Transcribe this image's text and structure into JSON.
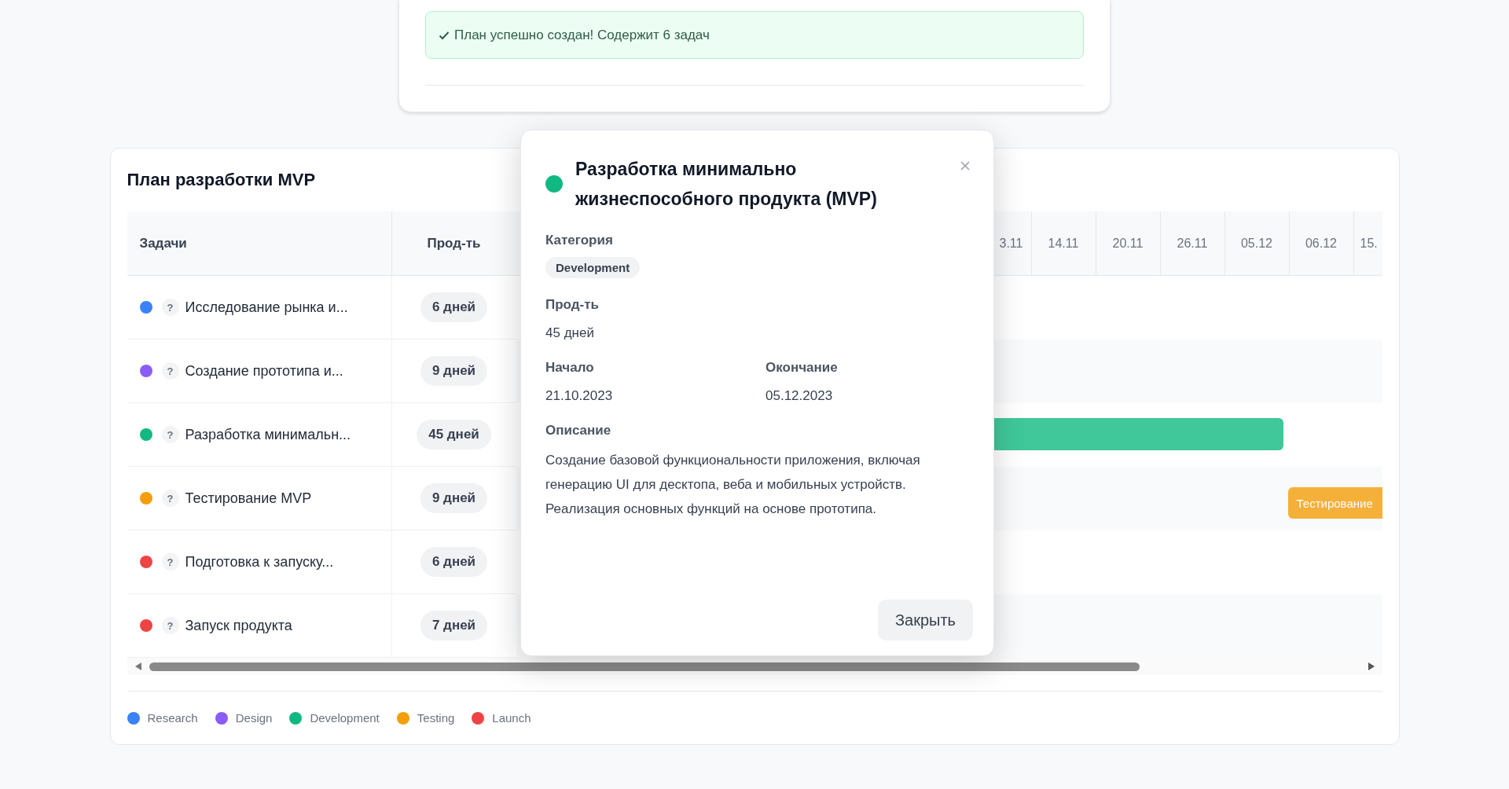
{
  "banner": {
    "text": "План успешно создан! Содержит 6 задач"
  },
  "plan": {
    "title": "План разработки MVP",
    "columns": {
      "tasks": "Задачи",
      "duration": "Прод-ть"
    },
    "dates": [
      "3.11",
      "14.11",
      "20.11",
      "26.11",
      "05.12",
      "06.12",
      "15."
    ],
    "tasks": [
      {
        "name": "Исследование рынка и...",
        "help": "?",
        "color": "#3b82f6",
        "duration": "6 дней"
      },
      {
        "name": "Создание прототипа и...",
        "help": "?",
        "color": "#8b5cf6",
        "duration": "9 дней"
      },
      {
        "name": "Разработка минимальн...",
        "help": "?",
        "color": "#10b981",
        "duration": "45 дней",
        "bar": {
          "kind": "plain"
        }
      },
      {
        "name": "Тестирование MVP",
        "help": "?",
        "color": "#f59e0b",
        "duration": "9 дней",
        "bar": {
          "kind": "labeled",
          "label": "Тестирование"
        }
      },
      {
        "name": "Подготовка к запуску...",
        "help": "?",
        "color": "#ef4444",
        "duration": "6 дней"
      },
      {
        "name": "Запуск продукта",
        "help": "?",
        "color": "#ef4444",
        "duration": "7 дней"
      }
    ],
    "legend": [
      {
        "label": "Research",
        "color": "#3b82f6"
      },
      {
        "label": "Design",
        "color": "#8b5cf6"
      },
      {
        "label": "Development",
        "color": "#10b981"
      },
      {
        "label": "Testing",
        "color": "#f59e0b"
      },
      {
        "label": "Launch",
        "color": "#ef4444"
      }
    ]
  },
  "modal": {
    "title": "Разработка минимально жизнеспособного продукта (MVP)",
    "color": "#10b981",
    "category_label": "Категория",
    "category": "Development",
    "duration_label": "Прод-ть",
    "duration": "45 дней",
    "start_label": "Начало",
    "start": "21.10.2023",
    "end_label": "Окончание",
    "end": "05.12.2023",
    "description_label": "Описание",
    "description": "Создание базовой функциональности приложения, включая генерацию UI для десктопа, веба и мобильных устройств. Реализация основных функций на основе прототипа.",
    "button": "Закрыть"
  }
}
